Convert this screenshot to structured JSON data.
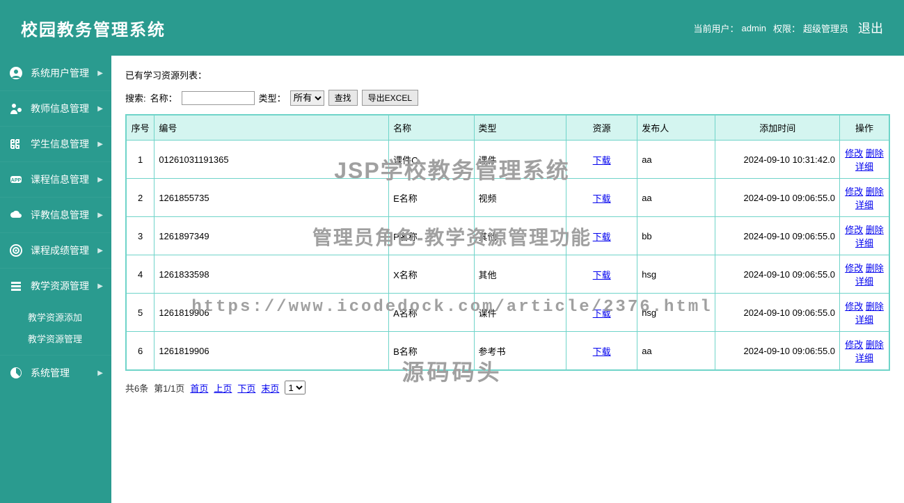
{
  "header": {
    "title": "校园教务管理系统",
    "current_user_label": "当前用户：",
    "current_user": "admin",
    "role_label": "权限：",
    "role": "超级管理员",
    "logout": "退出"
  },
  "sidebar": {
    "items": [
      {
        "icon": "user-circle-icon",
        "label": "系统用户管理"
      },
      {
        "icon": "teacher-icon",
        "label": "教师信息管理"
      },
      {
        "icon": "student-icon",
        "label": "学生信息管理"
      },
      {
        "icon": "app-icon",
        "label": "课程信息管理"
      },
      {
        "icon": "cloud-icon",
        "label": "评教信息管理"
      },
      {
        "icon": "target-icon",
        "label": "课程成绩管理"
      },
      {
        "icon": "stack-icon",
        "label": "教学资源管理",
        "expanded": true,
        "children": [
          {
            "label": "教学资源添加"
          },
          {
            "label": "教学资源管理"
          }
        ]
      },
      {
        "icon": "chart-icon",
        "label": "系统管理"
      }
    ]
  },
  "main": {
    "list_title": "已有学习资源列表：",
    "search": {
      "search_label": "搜索:",
      "name_label": "名称：",
      "name_value": "",
      "type_label": "类型：",
      "type_selected": "所有",
      "find_btn": "查找",
      "export_btn": "导出EXCEL"
    },
    "table": {
      "headers": {
        "seq": "序号",
        "code": "编号",
        "name": "名称",
        "type": "类型",
        "resource": "资源",
        "publisher": "发布人",
        "add_time": "添加时间",
        "ops": "操作"
      },
      "download_label": "下载",
      "op_edit": "修改",
      "op_delete": "删除",
      "op_detail": "详细",
      "rows": [
        {
          "seq": "1",
          "code": "01261031191365",
          "name": "课件C",
          "type": "课件",
          "publisher": "aa",
          "add_time": "2024-09-10 10:31:42.0"
        },
        {
          "seq": "2",
          "code": "1261855735",
          "name": "E名称",
          "type": "视频",
          "publisher": "aa",
          "add_time": "2024-09-10 09:06:55.0"
        },
        {
          "seq": "3",
          "code": "1261897349",
          "name": "P名称",
          "type": "其他",
          "publisher": "bb",
          "add_time": "2024-09-10 09:06:55.0"
        },
        {
          "seq": "4",
          "code": "1261833598",
          "name": "X名称",
          "type": "其他",
          "publisher": "hsg",
          "add_time": "2024-09-10 09:06:55.0"
        },
        {
          "seq": "5",
          "code": "1261819906",
          "name": "A名称",
          "type": "课件",
          "publisher": "hsg",
          "add_time": "2024-09-10 09:06:55.0"
        },
        {
          "seq": "6",
          "code": "1261819906",
          "name": "B名称",
          "type": "参考书",
          "publisher": "aa",
          "add_time": "2024-09-10 09:06:55.0"
        }
      ]
    },
    "pagination": {
      "total": "共6条",
      "page_info": "第1/1页",
      "first": "首页",
      "prev": "上页",
      "next": "下页",
      "last": "末页",
      "page_selected": "1"
    }
  },
  "watermarks": {
    "w1": "JSP学校教务管理系统",
    "w2": "管理员角色-教学资源管理功能",
    "w3": "https://www.icodedock.com/article/2376.html",
    "w4": "源码码头"
  }
}
